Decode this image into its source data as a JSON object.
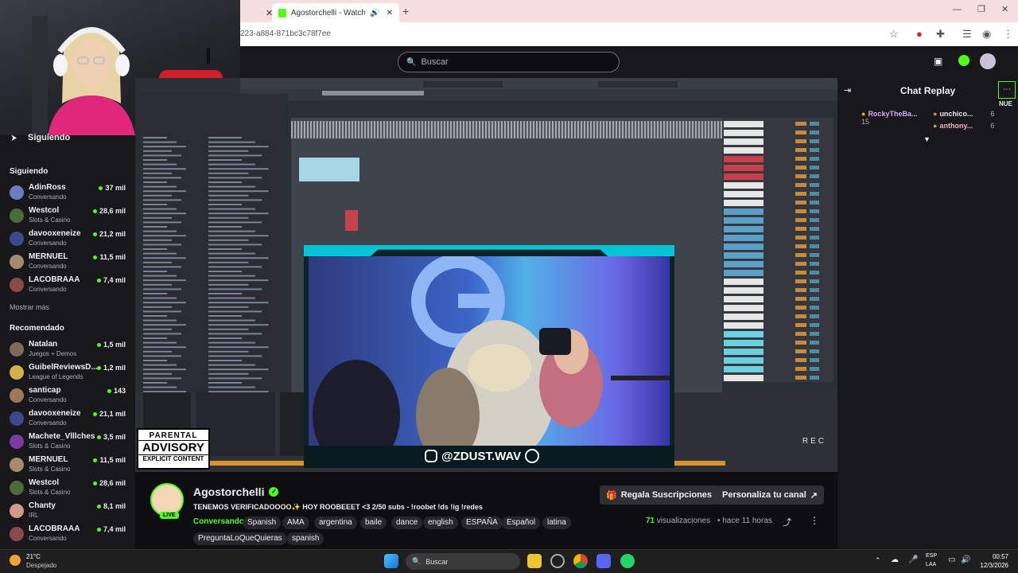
{
  "browser": {
    "tab_active_title": "Agostorchelli - Watch the V",
    "url": "223-a884-871bc3c78f7ee"
  },
  "topbar": {
    "search_placeholder": "Buscar"
  },
  "sidebar": {
    "header": "Siguiendo",
    "following_title": "Siguiendo",
    "show_more": "Mostrar más",
    "recommended_title": "Recomendado",
    "following": [
      {
        "name": "AdinRoss",
        "category": "Conversando",
        "viewers": "37 mil",
        "color": "#6a7dbd"
      },
      {
        "name": "Westcol",
        "category": "Slots & Casino",
        "viewers": "28,6 mil",
        "color": "#4b6b3a"
      },
      {
        "name": "davooxeneize",
        "category": "Conversando",
        "viewers": "21,2 mil",
        "color": "#3b4a8a"
      },
      {
        "name": "MERNUEL",
        "category": "Conversando",
        "viewers": "11,5 mil",
        "color": "#a58a6b"
      },
      {
        "name": "LACOBRAAA",
        "category": "Conversando",
        "viewers": "7,4 mil",
        "color": "#8a4a4a"
      }
    ],
    "recommended": [
      {
        "name": "Natalan",
        "category": "Juegos + Demos",
        "viewers": "1,5 mil",
        "color": "#7b6b5b"
      },
      {
        "name": "GuibelReviewsD...",
        "category": "League of Legends",
        "viewers": "1,2 mil",
        "color": "#d4b24a"
      },
      {
        "name": "santicap",
        "category": "Conversando",
        "viewers": "143",
        "color": "#9a7a5a"
      },
      {
        "name": "davooxeneize",
        "category": "Conversando",
        "viewers": "21,1 mil",
        "color": "#3b4a8a"
      },
      {
        "name": "Machete_Vlllches",
        "category": "Slots & Casino",
        "viewers": "3,5 mil",
        "color": "#7a3aa0"
      },
      {
        "name": "MERNUEL",
        "category": "Slots & Casino",
        "viewers": "11,5 mil",
        "color": "#a58a6b"
      },
      {
        "name": "Westcol",
        "category": "Slots & Casino",
        "viewers": "28,6 mil",
        "color": "#4b6b3a"
      },
      {
        "name": "Chanty",
        "category": "IRL",
        "viewers": "8,1 mil",
        "color": "#d09a8a"
      },
      {
        "name": "LACOBRAAA",
        "category": "Conversando",
        "viewers": "7,4 mil",
        "color": "#8a4a4a"
      }
    ]
  },
  "stream": {
    "instagram_handle": "@ZDUST.WAV",
    "rec_label": "REC",
    "advisory_line1": "PARENTAL",
    "advisory_line2": "ADVISORY",
    "advisory_line3": "EXPLICIT CONTENT"
  },
  "chat": {
    "title": "Chat Replay",
    "badge_new": "NUE",
    "messages": [
      {
        "user": "RockyTheBa...",
        "sub": "15",
        "color": "#d9a8ff"
      },
      {
        "user": "unchico...",
        "sub": "6",
        "color": "#e8e8e8"
      },
      {
        "user": "anthony...",
        "sub": "6",
        "color": "#f0b2c6"
      }
    ]
  },
  "info": {
    "streamer": "Agostorchelli",
    "live_badge": "LIVE",
    "title": "TENEMOS VERIFICADOOOO✨ HOY ROOBEEET <3 2/50 subs - !roobet !ds !ig !redes",
    "category": "Conversando",
    "tags": [
      "Spanish",
      "AMA",
      "argentina",
      "baile",
      "dance",
      "english",
      "ESPAÑA",
      "Español",
      "latina",
      "PreguntaLoQueQuieras",
      "spanish"
    ],
    "gift_button": "Regala Suscripciones",
    "customize_button": "Personaliza tu canal",
    "views_count": "71",
    "views_label": "visualizaciones",
    "time_ago": "hace 11 horas"
  },
  "taskbar": {
    "temperature": "21°C",
    "weather": "Despejado",
    "search_placeholder": "Buscar",
    "lang_top": "ESP",
    "lang_bottom": "LAA",
    "time": "00:57",
    "date": "12/3/2026"
  },
  "colors": {
    "accent": "#53fc18",
    "background": "#0e0e10",
    "panel": "#18181b"
  }
}
